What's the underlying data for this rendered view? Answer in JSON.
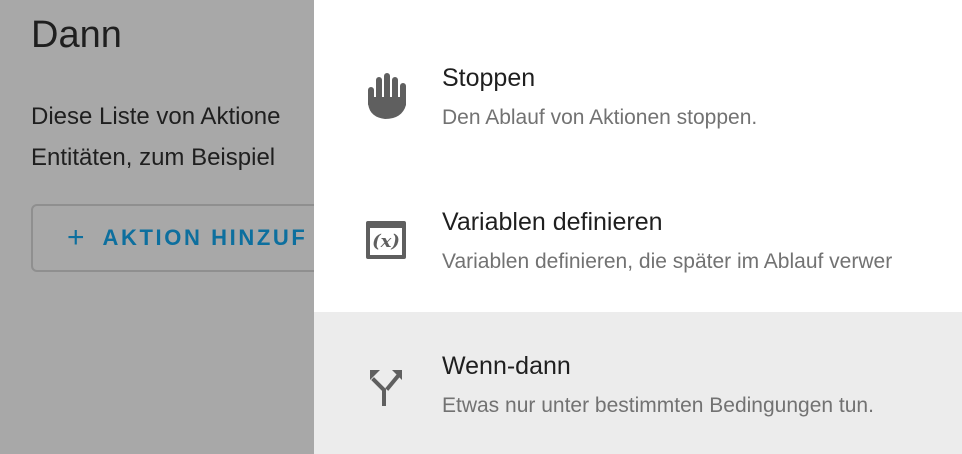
{
  "background": {
    "title": "Dann",
    "description_line1": "Diese Liste von Aktione",
    "description_line2": "Entitäten, zum Beispiel",
    "add_button_plus": "+",
    "add_button_label": "AKTION HINZUF"
  },
  "dialog": {
    "items": [
      {
        "title": "Stoppen",
        "subtitle": "Den Ablauf von Aktionen stoppen.",
        "icon": "hand-stop-icon",
        "selected": false
      },
      {
        "title": "Variablen definieren",
        "subtitle": "Variablen definieren, die später im Ablauf verwer",
        "icon": "variable-icon",
        "icon_text": "(x)",
        "selected": false
      },
      {
        "title": "Wenn-dann",
        "subtitle": "Etwas nur unter bestimmten Bedingungen tun.",
        "icon": "call-split-icon",
        "selected": true
      }
    ]
  },
  "colors": {
    "overlay": "#a8a8a8",
    "accent": "#0d6f9e",
    "selected_row": "#ececec",
    "icon": "#5f5f5f"
  }
}
